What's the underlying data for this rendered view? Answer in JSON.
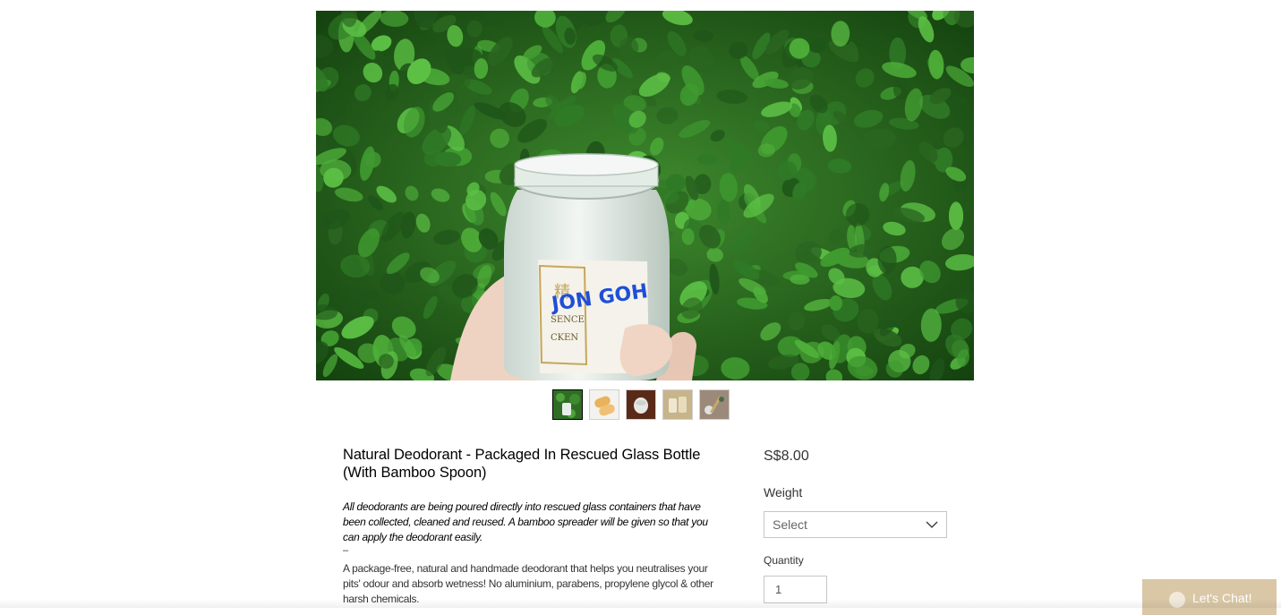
{
  "gallery": {
    "main_image_alt": "Glass jar of natural deodorant held against green leaves",
    "jar_label_text": "JON GOH",
    "thumbnails": [
      {
        "name": "thumbnail-1",
        "active": true
      },
      {
        "name": "thumbnail-2",
        "active": false
      },
      {
        "name": "thumbnail-3",
        "active": false
      },
      {
        "name": "thumbnail-4",
        "active": false
      },
      {
        "name": "thumbnail-5",
        "active": false
      }
    ]
  },
  "product": {
    "title": "Natural Deodorant - Packaged In Rescued Glass Bottle (With Bamboo Spoon)",
    "description_italic": "All deodorants are being poured directly into rescued glass containers that have been collected, cleaned and reused. A bamboo spreader will be given so that you can apply the deodorant easily.",
    "description_separator": "–",
    "description_body": "A package-free, natural and handmade deodorant that helps you neutralises your pits' odour and absorb wetness! No aluminium, parabens, propylene glycol & other harsh chemicals.",
    "price": "S$8.00"
  },
  "options": {
    "weight_label": "Weight",
    "weight_select_value": "Select",
    "quantity_label": "Quantity",
    "quantity_value": "1"
  },
  "chat": {
    "label": "Let's Chat!"
  },
  "colors": {
    "chat_bg": "#d9c7a6",
    "leaf_dark": "#1f5a1c",
    "leaf_light": "#4fa33a"
  }
}
